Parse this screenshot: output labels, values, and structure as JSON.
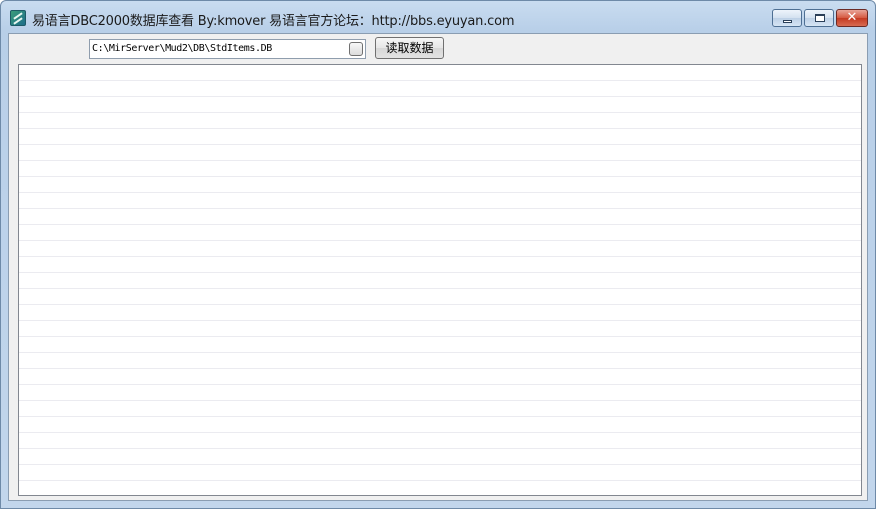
{
  "window": {
    "title": "易语言DBC2000数据库查看 By:kmover  易语言官方论坛：http://bbs.eyuyan.com",
    "icon": "app-icon",
    "controls": {
      "minimize_icon": "minimize-icon",
      "maximize_icon": "maximize-icon",
      "close_symbol": "✕"
    }
  },
  "toolbar": {
    "path_value": "C:\\MirServer\\Mud2\\DB\\StdItems.DB",
    "browse_icon": "browse-icon",
    "read_button_label": "读取数据"
  },
  "grid": {
    "rows": []
  }
}
